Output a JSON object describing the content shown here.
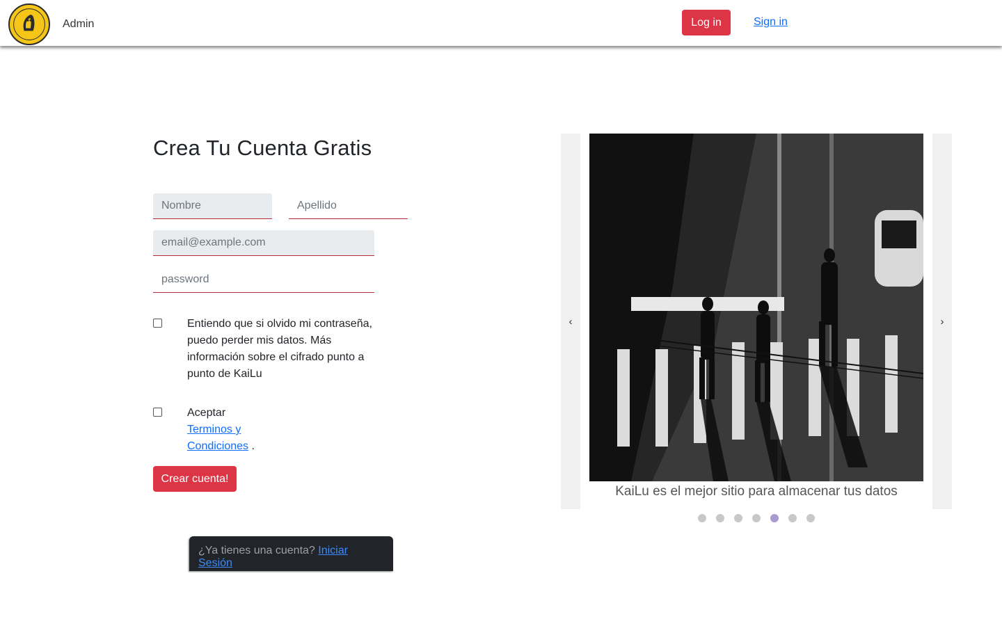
{
  "navbar": {
    "brand_label": "Admin",
    "login_label": "Log in",
    "signin_label": "Sign in"
  },
  "form": {
    "title": "Crea Tu Cuenta Gratis",
    "nombre_placeholder": "Nombre",
    "apellido_placeholder": "Apellido",
    "email_placeholder": "email@example.com",
    "password_placeholder": "password",
    "checkbox1_text": "Entiendo que si olvido mi contraseña, puedo perder mis datos. Más información sobre el cifrado punto a punto de KaiLu",
    "checkbox2_prefix": "Aceptar",
    "checkbox2_link": "Terminos y Condiciones",
    "checkbox2_suffix": ".",
    "submit_label": "Crear cuenta!"
  },
  "toast": {
    "text": "¿Ya tienes una cuenta?",
    "link": "Iniciar Sesión"
  },
  "carousel": {
    "prev_label": "‹",
    "next_label": "›",
    "caption": "KaiLu es el mejor sitio para almacenar tus datos",
    "slide_count": 7,
    "active_index": 4
  },
  "colors": {
    "primary_red": "#dc3545",
    "link_blue": "#0d6efd",
    "toast_bg": "#212529",
    "dot_active": "#a99bd0"
  }
}
